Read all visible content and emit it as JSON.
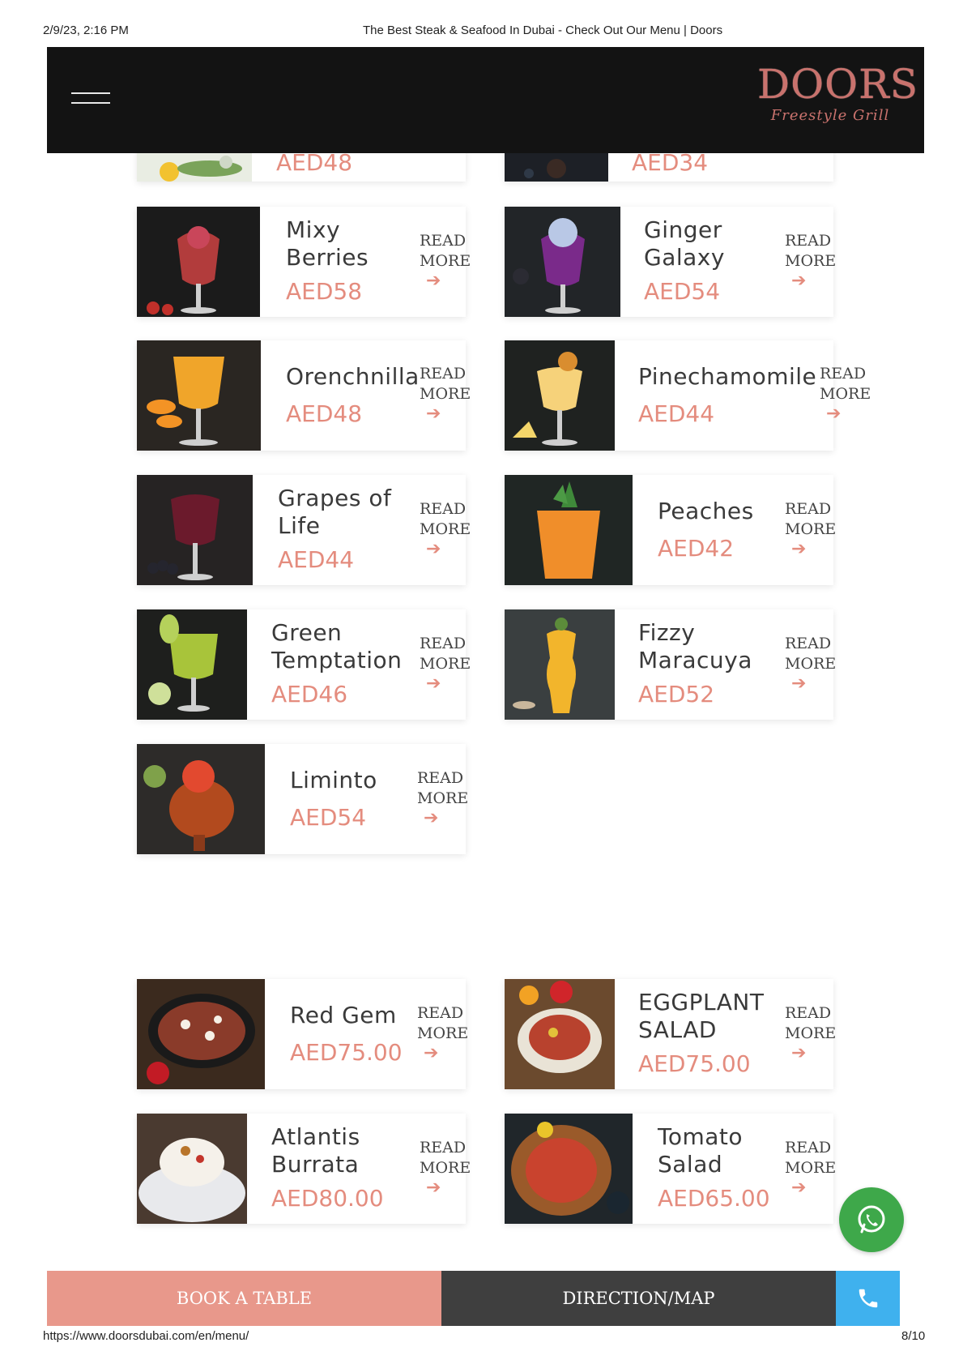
{
  "print_header": {
    "date": "2/9/23, 2:16 PM",
    "title": "The Best Steak & Seafood In Dubai - Check Out Our Menu | Doors"
  },
  "print_footer": {
    "url": "https://www.doorsdubai.com/en/menu/",
    "page": "8/10"
  },
  "header": {
    "menu_icon": "hamburger-icon",
    "logo_main": "DOORS",
    "logo_sub": "Freestyle Grill"
  },
  "partial_cards": [
    {
      "price": "AED48"
    },
    {
      "price": "AED34"
    }
  ],
  "read_more_label": "READ MORE",
  "cocktails": [
    {
      "name": "Mixy Berries",
      "price": "AED58"
    },
    {
      "name": "Ginger Galaxy",
      "price": "AED54"
    },
    {
      "name": "Orenchnilla",
      "price": "AED48"
    },
    {
      "name": "Pinechamomile",
      "price": "AED44"
    },
    {
      "name": "Grapes of Life",
      "price": "AED44"
    },
    {
      "name": "Peaches",
      "price": "AED42"
    },
    {
      "name": "Green Temptation",
      "price": "AED46"
    },
    {
      "name": "Fizzy Maracuya",
      "price": "AED52"
    },
    {
      "name": "Liminto",
      "price": "AED54"
    }
  ],
  "salads": [
    {
      "name": "Red Gem",
      "price": "AED75.00"
    },
    {
      "name": "EGGPLANT SALAD",
      "price": "AED75.00"
    },
    {
      "name": "Atlantis Burrata",
      "price": "AED80.00"
    },
    {
      "name": "Tomato Salad",
      "price": "AED65.00"
    }
  ],
  "bottom_bar": {
    "book_label": "BOOK A TABLE",
    "map_label": "DIRECTION/MAP",
    "call_icon": "phone-icon"
  },
  "whatsapp_icon": "whatsapp-icon",
  "colors": {
    "accent": "#e48c7e",
    "header_bg": "#131313",
    "book_bg": "#e8988b",
    "map_bg": "#3f3f3f",
    "call_bg": "#3fb1ee",
    "whatsapp_bg": "#3ea84a"
  }
}
